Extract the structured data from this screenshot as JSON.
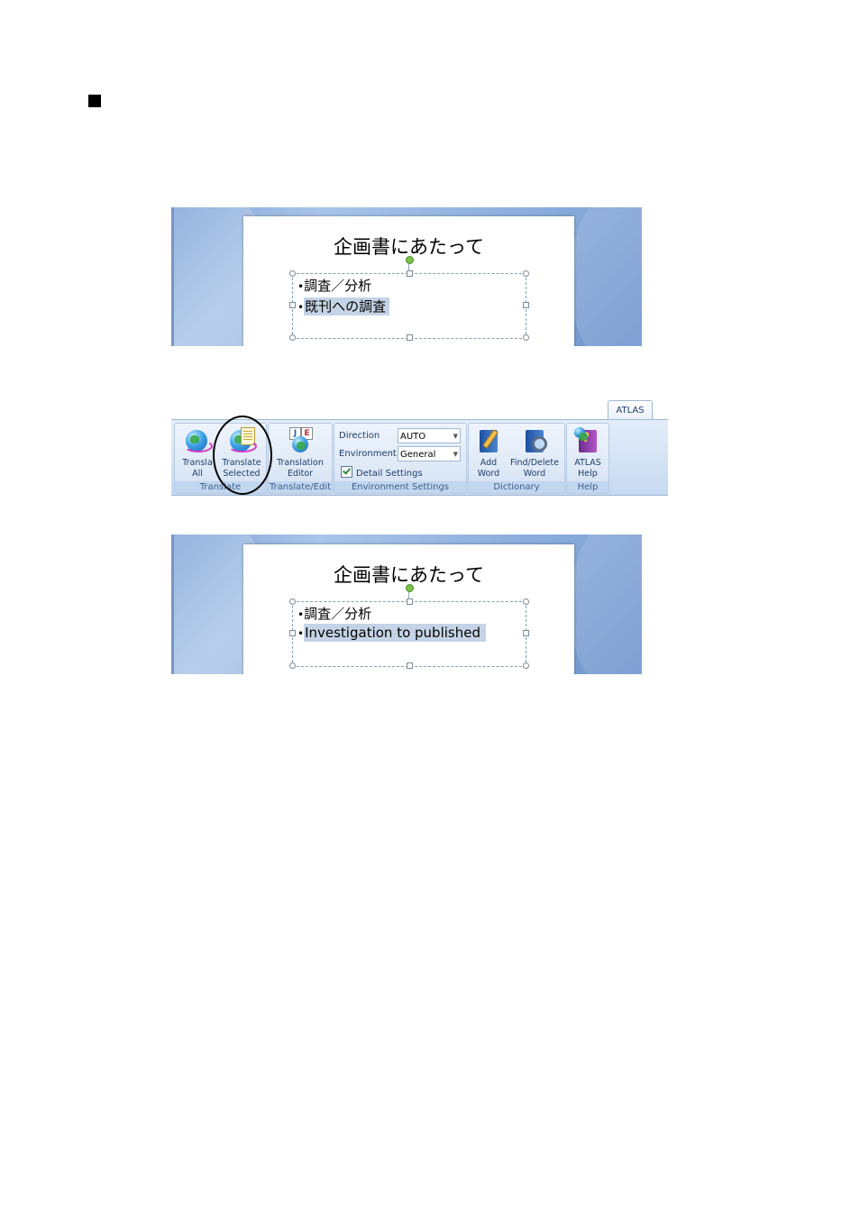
{
  "slide_before": {
    "title": "企画書にあたって",
    "bullet": "•",
    "line1": "調査／分析",
    "line2": "既刊への調査"
  },
  "slide_after": {
    "title": "企画書にあたって",
    "bullet": "•",
    "line1": "調査／分析",
    "line2": "Investigation to published"
  },
  "ribbon": {
    "tab_label": "ATLAS",
    "groups": {
      "translate": {
        "label": "Translate",
        "translate_all": [
          "Transla",
          "All"
        ],
        "translate_selected": [
          "Translate",
          "Selected"
        ]
      },
      "translate_edit": {
        "label": "Translate/Edit",
        "translation_editor": [
          "Translation",
          "Editor"
        ],
        "je_letters": [
          "J",
          "E"
        ]
      },
      "environment": {
        "label": "Environment Settings",
        "direction_label": "Direction",
        "direction_value": "AUTO",
        "environment_label": "Environment",
        "environment_value": "General",
        "detail_settings": "Detail Settings"
      },
      "dictionary": {
        "label": "Dictionary",
        "add_word": [
          "Add",
          "Word"
        ],
        "find_delete_word": [
          "Find/Delete",
          "Word"
        ]
      },
      "help": {
        "label": "Help",
        "atlas_help": [
          "ATLAS",
          "Help"
        ],
        "help_icon_glyph": "?"
      }
    }
  },
  "colors": {
    "selection_highlight": "#c5d3e6",
    "slide_background": "#8fb0de",
    "ribbon_background": "#d4e3f5",
    "group_label_text": "#3e5f8a"
  }
}
